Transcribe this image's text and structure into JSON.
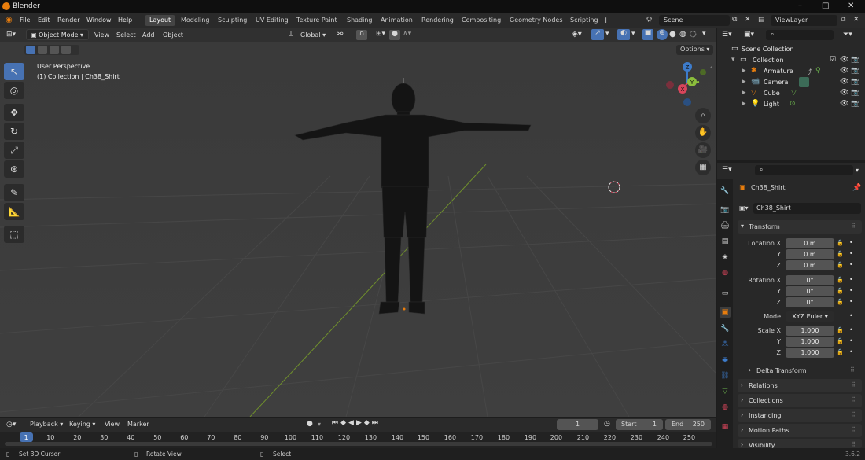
{
  "window": {
    "title": "Blender",
    "version": "3.6.2"
  },
  "menus": [
    "File",
    "Edit",
    "Render",
    "Window",
    "Help"
  ],
  "workspaces": [
    "Layout",
    "Modeling",
    "Sculpting",
    "UV Editing",
    "Texture Paint",
    "Shading",
    "Animation",
    "Rendering",
    "Compositing",
    "Geometry Nodes",
    "Scripting"
  ],
  "active_workspace": "Layout",
  "scene": {
    "name": "Scene",
    "view_layer": "ViewLayer"
  },
  "viewport_header": {
    "mode": "Object Mode",
    "menus": [
      "View",
      "Select",
      "Add",
      "Object"
    ],
    "orientation": "Global",
    "options_label": "Options"
  },
  "viewport": {
    "perspective": "User Perspective",
    "collection_info": "(1) Collection | Ch38_Shirt"
  },
  "gizmo": {
    "x": "X",
    "y": "Y",
    "z": "Z"
  },
  "outliner": {
    "rows": [
      {
        "label": "Scene Collection",
        "icon": "scene-collection-icon"
      },
      {
        "label": "Collection",
        "icon": "collection-icon"
      },
      {
        "label": "Armature",
        "icon": "armature-icon"
      },
      {
        "label": "Camera",
        "icon": "camera-icon"
      },
      {
        "label": "Cube",
        "icon": "mesh-icon"
      },
      {
        "label": "Light",
        "icon": "light-icon"
      }
    ]
  },
  "properties": {
    "object_name": "Ch38_Shirt",
    "object_field": "Ch38_Shirt",
    "transform_label": "Transform",
    "location_label": "Location X",
    "location": [
      "0 m",
      "0 m",
      "0 m"
    ],
    "rotation_label": "Rotation X",
    "rotation": [
      "0°",
      "0°",
      "0°"
    ],
    "mode_label": "Mode",
    "mode_value": "XYZ Euler",
    "scale_label": "Scale X",
    "scale": [
      "1.000",
      "1.000",
      "1.000"
    ],
    "axis_y": "Y",
    "axis_z": "Z",
    "delta_transform": "Delta Transform",
    "panels": [
      "Relations",
      "Collections",
      "Instancing",
      "Motion Paths",
      "Visibility"
    ]
  },
  "timeline": {
    "menus": [
      "Playback",
      "Keying",
      "View",
      "Marker"
    ],
    "current_frame": "1",
    "start_label": "Start",
    "start": "1",
    "end_label": "End",
    "end": "250",
    "ruler": [
      "1",
      "10",
      "20",
      "30",
      "40",
      "50",
      "60",
      "70",
      "80",
      "90",
      "100",
      "110",
      "120",
      "130",
      "140",
      "150",
      "160",
      "170",
      "180",
      "190",
      "200",
      "210",
      "220",
      "230",
      "240",
      "250"
    ]
  },
  "status": {
    "left": "Set 3D Cursor",
    "middle": "Rotate View",
    "right": "Select"
  },
  "colors": {
    "accent": "#4772b3",
    "x_axis": "#d8455b",
    "y_axis": "#8bbd3c",
    "z_axis": "#3d7ccc",
    "object_orange": "#e87d0d"
  }
}
